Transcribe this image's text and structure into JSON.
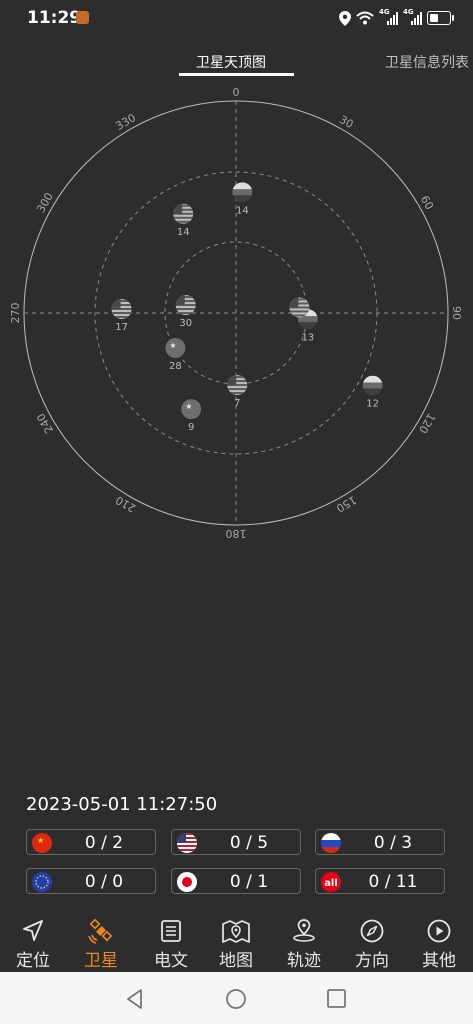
{
  "status_bar": {
    "time": "11:29",
    "network_label_1": "4G",
    "network_label_2": "4G"
  },
  "tabs": [
    {
      "label": "卫星天顶图",
      "active": true
    },
    {
      "label": "卫星信息列表",
      "active": false
    }
  ],
  "skyplot": {
    "azimuth_labels": [
      "0",
      "30",
      "60",
      "90",
      "120",
      "150",
      "180",
      "210",
      "240",
      "270",
      "300",
      "330"
    ],
    "satellites": [
      {
        "id": "14",
        "system": "russia",
        "azimuth": 3,
        "elevation_ring": 0.57
      },
      {
        "id": "14",
        "system": "usa",
        "azimuth": 332,
        "elevation_ring": 0.53
      },
      {
        "id": "17",
        "system": "usa",
        "azimuth": 272,
        "elevation_ring": 0.54
      },
      {
        "id": "30",
        "system": "usa",
        "azimuth": 279,
        "elevation_ring": 0.24
      },
      {
        "id": "28",
        "system": "china",
        "azimuth": 240,
        "elevation_ring": 0.33
      },
      {
        "id": "7",
        "system": "usa",
        "azimuth": 179,
        "elevation_ring": 0.34
      },
      {
        "id": "9",
        "system": "china",
        "azimuth": 205,
        "elevation_ring": 0.5
      },
      {
        "id": "13",
        "system": "russia",
        "azimuth": 95,
        "elevation_ring": 0.34
      },
      {
        "id": "",
        "system": "usa",
        "azimuth": 85,
        "elevation_ring": 0.3
      },
      {
        "id": "12",
        "system": "russia",
        "azimuth": 118,
        "elevation_ring": 0.73
      }
    ],
    "colors": {
      "ring": "#bdbdbd",
      "grid": "#8a8a8a",
      "label": "#a8a8a8"
    }
  },
  "datetime": "2023-05-01  11:27:50",
  "constellation_counts": [
    {
      "system": "china",
      "icon": "china-flag-icon",
      "text": "0 / 2"
    },
    {
      "system": "usa",
      "icon": "usa-flag-icon",
      "text": "0 / 5"
    },
    {
      "system": "russia",
      "icon": "russia-flag-icon",
      "text": "0 / 3"
    },
    {
      "system": "eu",
      "icon": "eu-flag-icon",
      "text": "0 / 0"
    },
    {
      "system": "japan",
      "icon": "japan-flag-icon",
      "text": "0 / 1"
    },
    {
      "system": "all",
      "icon": "all-icon",
      "text": "0 / 11",
      "icon_text": "all"
    }
  ],
  "bottom_nav": [
    {
      "label": "定位",
      "icon": "navigation-arrow-icon",
      "active": false
    },
    {
      "label": "卫星",
      "icon": "satellite-icon",
      "active": true
    },
    {
      "label": "电文",
      "icon": "document-icon",
      "active": false
    },
    {
      "label": "地图",
      "icon": "map-icon",
      "active": false
    },
    {
      "label": "轨迹",
      "icon": "track-pin-icon",
      "active": false
    },
    {
      "label": "方向",
      "icon": "compass-icon",
      "active": false
    },
    {
      "label": "其他",
      "icon": "play-circle-icon",
      "active": false
    }
  ],
  "accent_color": "#f0891c"
}
